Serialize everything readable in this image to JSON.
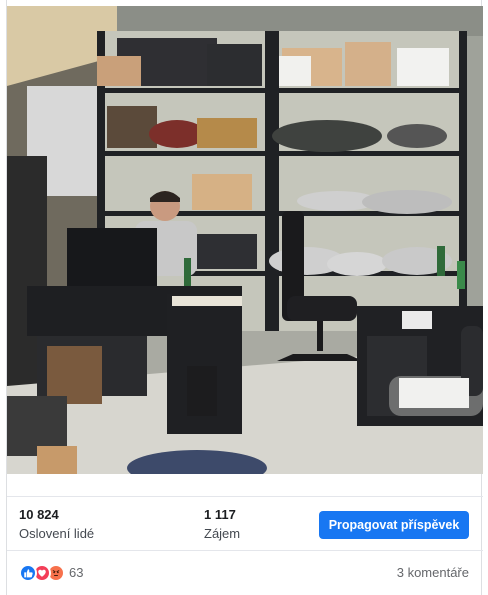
{
  "post": {
    "photo_description": ""
  },
  "stats": {
    "reached_value": "10 824",
    "reached_label": "Oslovení lidé",
    "engagement_value": "1 117",
    "engagement_label": "Zájem"
  },
  "actions": {
    "boost_label": "Propagovat příspěvek"
  },
  "footer": {
    "reaction_icons": [
      "like-icon",
      "love-icon",
      "angry-icon"
    ],
    "reaction_count": "63",
    "comments_label": "3 komentáře"
  },
  "colors": {
    "accent": "#1877f2",
    "like": "#1877f2",
    "love": "#f33e58",
    "angry": "#f7714c"
  }
}
